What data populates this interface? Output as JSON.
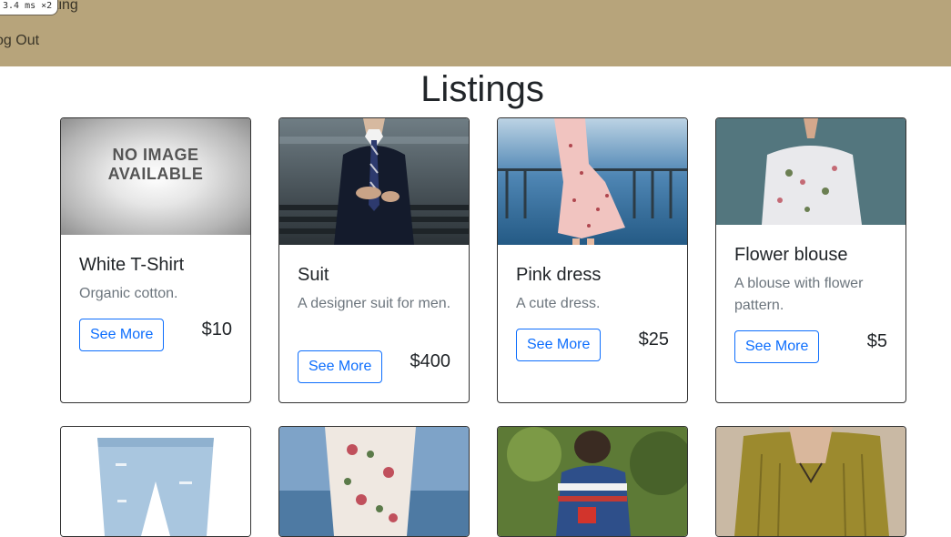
{
  "nav": {
    "perf_badge": "3.4 ms ×2",
    "partial_link": "ting",
    "logout_label": "og Out"
  },
  "page": {
    "title": "Listings"
  },
  "listings": [
    {
      "title": "White T-Shirt",
      "description": "Organic cotton.",
      "price": "$10",
      "button": "See More",
      "image": "no-image-placeholder",
      "placeholder_text": "NO IMAGE AVAILABLE"
    },
    {
      "title": "Suit",
      "description": "A designer suit for men.",
      "price": "$400",
      "button": "See More",
      "image": "suit-photo"
    },
    {
      "title": "Pink dress",
      "description": "A cute dress.",
      "price": "$25",
      "button": "See More",
      "image": "pink-dress-photo"
    },
    {
      "title": "Flower blouse",
      "description": "A blouse with flower pattern.",
      "price": "$5",
      "button": "See More",
      "image": "flower-blouse-photo"
    },
    {
      "image": "denim-shorts-photo"
    },
    {
      "image": "floral-dress-photo"
    },
    {
      "image": "knit-sweater-photo"
    },
    {
      "image": "cardigan-photo"
    }
  ],
  "colors": {
    "navbar": "#b7a47b",
    "button": "#0d6efd",
    "border": "#333333"
  }
}
